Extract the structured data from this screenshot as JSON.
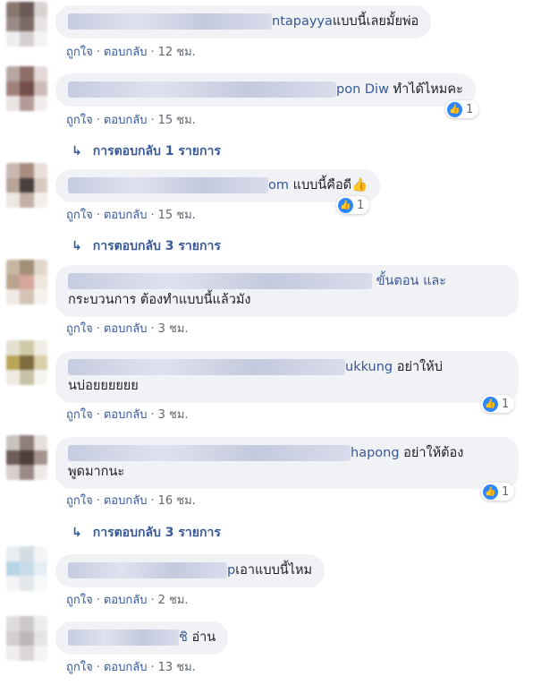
{
  "comments": [
    {
      "name_tail": "ntapayya",
      "text": "แบบนี้เลยมั้ยพ่อ",
      "text2": "",
      "like": "ถูกใจ",
      "reply": "ตอบกลับ",
      "time": "12 ชม.",
      "reactions": "",
      "replies": ""
    },
    {
      "name_tail": "pon Diw",
      "text": "ทำได้ไหมคะ",
      "text2": "",
      "like": "ถูกใจ",
      "reply": "ตอบกลับ",
      "time": "15 ชม.",
      "reactions": "1",
      "replies": "การตอบกลับ 1 รายการ"
    },
    {
      "name_tail": "om",
      "text": "แบบนี้คือดี👍",
      "text2": "",
      "like": "ถูกใจ",
      "reply": "ตอบกลับ",
      "time": "15 ชม.",
      "reactions": "1",
      "replies": "การตอบกลับ 3 รายการ"
    },
    {
      "name_tail": "",
      "text": "ขั้นตอน และ",
      "text2": "กระบวนการ ต้องทำแบบนี้แล้วมัง",
      "like": "ถูกใจ",
      "reply": "ตอบกลับ",
      "time": "3 ชม.",
      "reactions": "",
      "replies": ""
    },
    {
      "name_tail": "ukkung",
      "text": "อย่าให้บ่",
      "text2": "นบ่อยยยยยย",
      "like": "ถูกใจ",
      "reply": "ตอบกลับ",
      "time": "3 ชม.",
      "reactions": "1",
      "replies": ""
    },
    {
      "name_tail": "hapong",
      "text": "อย่าให้ต้อง",
      "text2": "พูดมากนะ",
      "like": "ถูกใจ",
      "reply": "ตอบกลับ",
      "time": "16 ชม.",
      "reactions": "1",
      "replies": "การตอบกลับ 3 รายการ"
    },
    {
      "name_tail": "p",
      "text": "เอาแบบนี้ไหม",
      "text2": "",
      "like": "ถูกใจ",
      "reply": "ตอบกลับ",
      "time": "2 ชม.",
      "reactions": "",
      "replies": ""
    },
    {
      "name_tail": "ชิ",
      "text": "อ่าน",
      "text2": "",
      "like": "ถูกใจ",
      "reply": "ตอบกลับ",
      "time": "13 ชม.",
      "reactions": "",
      "replies": ""
    }
  ],
  "icons": {
    "reply_arrow": "↳",
    "like": "👍"
  },
  "colors": {
    "link": "#385898",
    "bubble": "#f0f2f5",
    "meta": "#606770",
    "like_blue": "#2d88ff"
  }
}
